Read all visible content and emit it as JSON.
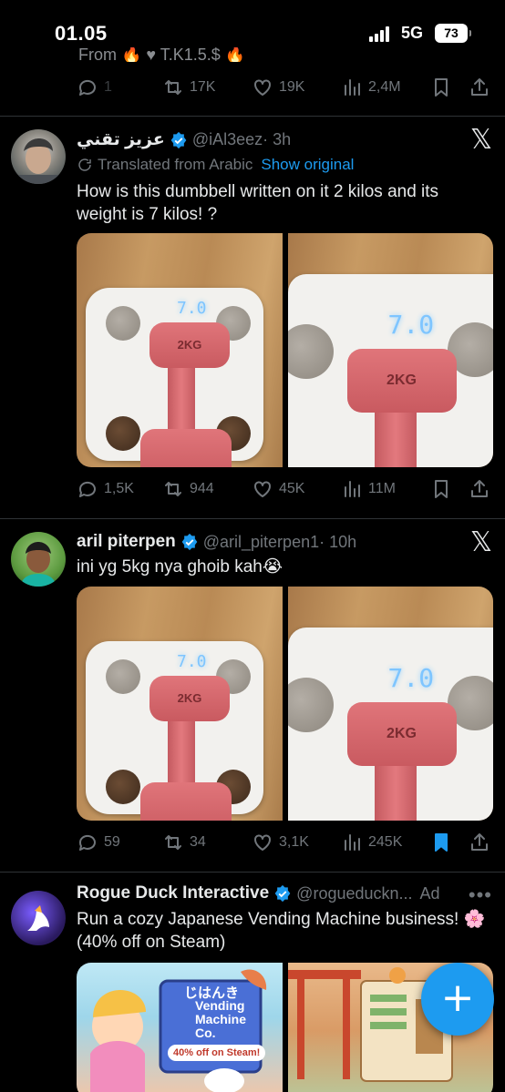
{
  "status_bar": {
    "time": "01.05",
    "network": "5G",
    "battery": "73"
  },
  "prev_tweet": {
    "text_fragment": "From 🔥 ♥ T.K1.5.$ 🔥",
    "replies": "1",
    "retweets": "17K",
    "likes": "19K",
    "views": "2,4M"
  },
  "tweets": [
    {
      "name": "عزيز تقني",
      "handle": "@iAl3eez",
      "time": "· 3h",
      "translated_label": "Translated from Arabic",
      "show_original": "Show original",
      "text": "How is this dumbbell written on it 2 kilos and its weight is 7 kilos! ?",
      "replies": "1,5K",
      "retweets": "944",
      "likes": "45K",
      "views": "11M",
      "images": [
        {
          "readout": "7.0",
          "label": "2KG"
        },
        {
          "readout": "7.0",
          "label": "2KG"
        }
      ]
    },
    {
      "name": "aril piterpen",
      "handle": "@aril_piterpen1",
      "time": "· 10h",
      "text": "ini yg 5kg nya ghoib kah😭",
      "replies": "59",
      "retweets": "34",
      "likes": "3,1K",
      "views": "245K",
      "bookmarked": true,
      "images": [
        {
          "readout": "7.0",
          "label": "2KG"
        },
        {
          "readout": "7.0",
          "label": "2KG"
        }
      ]
    }
  ],
  "ad": {
    "name": "Rogue Duck Interactive",
    "handle": "@rogueduckn...",
    "label": "Ad",
    "more": "•••",
    "text": "Run a cozy Japanese Vending Machine business! 🌸 (40% off on Steam)",
    "game_title_jp": "じはんき",
    "game_title": "Vending Machine Co.",
    "game_badge": "40% off on Steam!"
  },
  "fab_label": "+",
  "x_logo": "𝕏",
  "colors": {
    "accent": "#1d9bf0",
    "background": "#000000",
    "muted": "#71767b"
  }
}
